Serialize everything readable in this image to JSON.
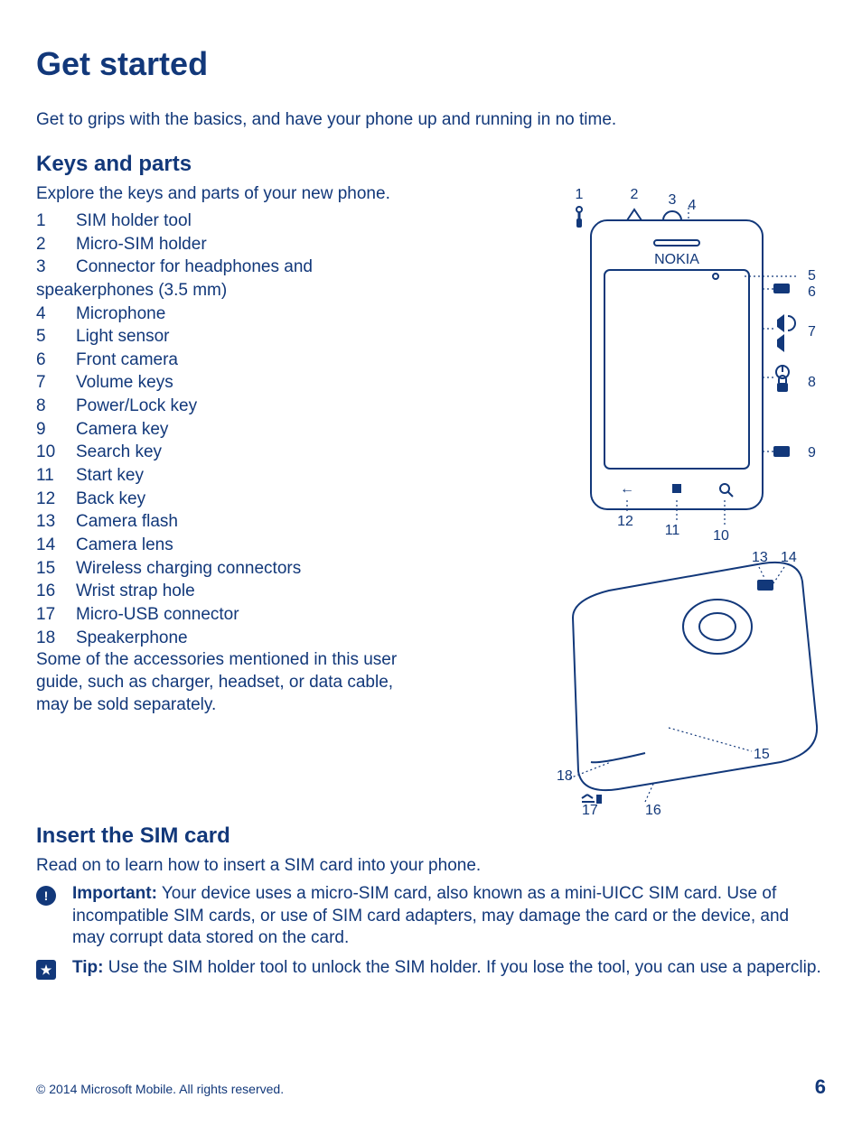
{
  "title": "Get started",
  "intro": "Get to grips with the basics, and have your phone up and running in no time.",
  "keys": {
    "heading": "Keys and parts",
    "intro": "Explore the keys and parts of your new phone.",
    "parts": [
      {
        "n": "1",
        "label": "SIM holder tool"
      },
      {
        "n": "2",
        "label": "Micro-SIM holder"
      },
      {
        "n": "3",
        "label": "Connector for headphones and"
      },
      {
        "n": "",
        "label": "speakerphones (3.5 mm)",
        "wrap": true
      },
      {
        "n": "4",
        "label": "Microphone"
      },
      {
        "n": "5",
        "label": "Light sensor"
      },
      {
        "n": "6",
        "label": "Front camera"
      },
      {
        "n": "7",
        "label": "Volume keys"
      },
      {
        "n": "8",
        "label": "Power/Lock key"
      },
      {
        "n": "9",
        "label": "Camera key"
      },
      {
        "n": "10",
        "label": "Search key"
      },
      {
        "n": "11",
        "label": "Start key"
      },
      {
        "n": "12",
        "label": "Back key"
      },
      {
        "n": "13",
        "label": "Camera flash"
      },
      {
        "n": "14",
        "label": "Camera lens"
      },
      {
        "n": "15",
        "label": "Wireless charging connectors"
      },
      {
        "n": "16",
        "label": "Wrist strap hole"
      },
      {
        "n": "17",
        "label": "Micro-USB connector"
      },
      {
        "n": "18",
        "label": "Speakerphone"
      }
    ],
    "accessories_note": "Some of the accessories mentioned in this user guide, such as charger, headset, or data cable, may be sold separately."
  },
  "diagram": {
    "front_labels": [
      "1",
      "2",
      "3",
      "4",
      "5",
      "6",
      "7",
      "8",
      "9",
      "10",
      "11",
      "12"
    ],
    "back_labels": [
      "13",
      "14",
      "15",
      "16",
      "17",
      "18"
    ]
  },
  "sim": {
    "heading": "Insert the SIM card",
    "intro": "Read on to learn how to insert a SIM card into your phone.",
    "important_label": "Important:",
    "important_text": " Your device uses a micro-SIM card, also known as a mini-UICC SIM card. Use of incompatible SIM cards, or use of SIM card adapters, may damage the card or the device, and may corrupt data stored on the card.",
    "tip_label": "Tip:",
    "tip_text": " Use the SIM holder tool to unlock the SIM holder. If you lose the tool, you can use a paperclip."
  },
  "footer": {
    "copyright": "© 2014 Microsoft Mobile. All rights reserved.",
    "page": "6"
  }
}
